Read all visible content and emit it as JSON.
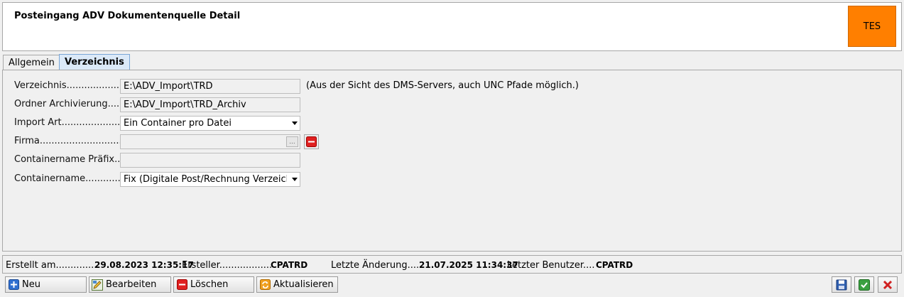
{
  "header": {
    "title": "Posteingang ADV Dokumentenquelle Detail",
    "badge": "TES",
    "badge_color": "#ff7f00"
  },
  "tabs": [
    {
      "label": "Allgemein",
      "active": false
    },
    {
      "label": "Verzeichnis",
      "active": true
    }
  ],
  "form": {
    "verzeichnis": {
      "label": "Verzeichnis......................",
      "value": "E:\\ADV_Import\\TRD",
      "hint": "(Aus der Sicht des DMS-Servers, auch UNC Pfade möglich.)"
    },
    "ordner_archivierung": {
      "label": "Ordner Archivierung.......",
      "value": "E:\\ADV_Import\\TRD_Archiv"
    },
    "import_art": {
      "label": "Import Art.........................",
      "value": "Ein Container pro Datei"
    },
    "firma": {
      "label": "Firma...................................",
      "value": "",
      "browse_label": "..."
    },
    "containername_praefix": {
      "label": "Containername Präfix.....",
      "value": ""
    },
    "containername": {
      "label": "Containername...............",
      "value": "Fix (Digitale Post/Rechnung Verzeichnis)"
    }
  },
  "status": {
    "erstellt_label": "Erstellt am..............",
    "erstellt_value": "29.08.2023 12:35:17",
    "ersteller_label": "Ersteller..................",
    "ersteller_value": "CPATRD",
    "letzte_aenderung_label": "Letzte Änderung.....",
    "letzte_aenderung_value": "21.07.2025 11:34:37",
    "letzter_benutzer_label": "Letzter Benutzer....",
    "letzter_benutzer_value": "CPATRD"
  },
  "toolbar": {
    "new_label": "Neu",
    "edit_label": "Bearbeiten",
    "delete_label": "Löschen",
    "refresh_label": "Aktualisieren"
  }
}
